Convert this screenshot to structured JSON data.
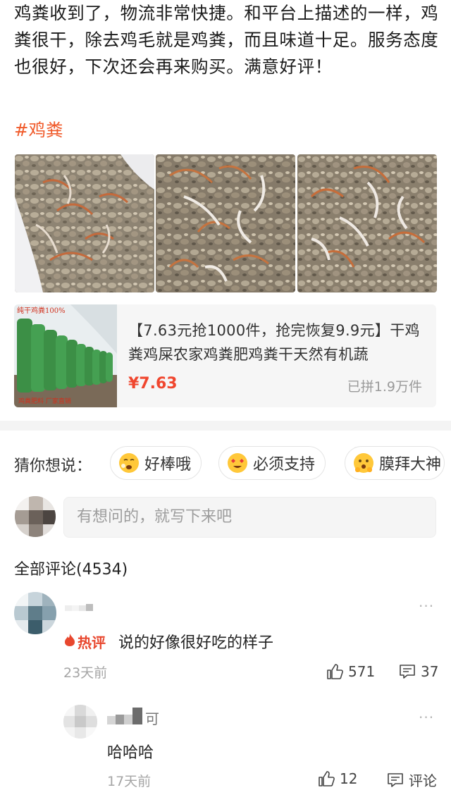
{
  "post": {
    "text": "鸡粪收到了，物流非常快捷。和平台上描述的一样，鸡粪很干，除去鸡毛就是鸡粪，而且味道十足。服务态度也很好，下次还会再来购买。满意好评！",
    "hashtag": "#鸡粪"
  },
  "product": {
    "thumb_text_top": "纯干鸡粪100%",
    "thumb_text_bottom": "鸡粪肥料 厂家直销",
    "title": "【7.63元抢1000件，抢完恢复9.9元】干鸡粪鸡屎农家鸡粪肥鸡粪干天然有机蔬",
    "price": "¥7.63",
    "sold": "已拼1.9万件"
  },
  "guess": {
    "label": "猜你想说：",
    "chips": [
      {
        "label": "好棒哦",
        "emoji": "yawn-face-icon"
      },
      {
        "label": "必须支持",
        "emoji": "heart-eyes-face-icon"
      },
      {
        "label": "膜拜大神",
        "emoji": "bowing-face-icon"
      }
    ]
  },
  "input": {
    "placeholder": "有想问的，就写下来吧"
  },
  "comments": {
    "header": "全部评论(4534)",
    "items": [
      {
        "badge": "热评",
        "text": "说的好像很好吃的样子",
        "time": "23天前",
        "likes": "571",
        "replies": "37",
        "more": "···"
      },
      {
        "name_tail": "可",
        "text": "哈哈哈",
        "time": "17天前",
        "likes": "12",
        "replies": "评论",
        "more": "···"
      }
    ]
  },
  "colors": {
    "accent": "#f05a2a",
    "price": "#f0462e",
    "hot": "#e8472e"
  }
}
